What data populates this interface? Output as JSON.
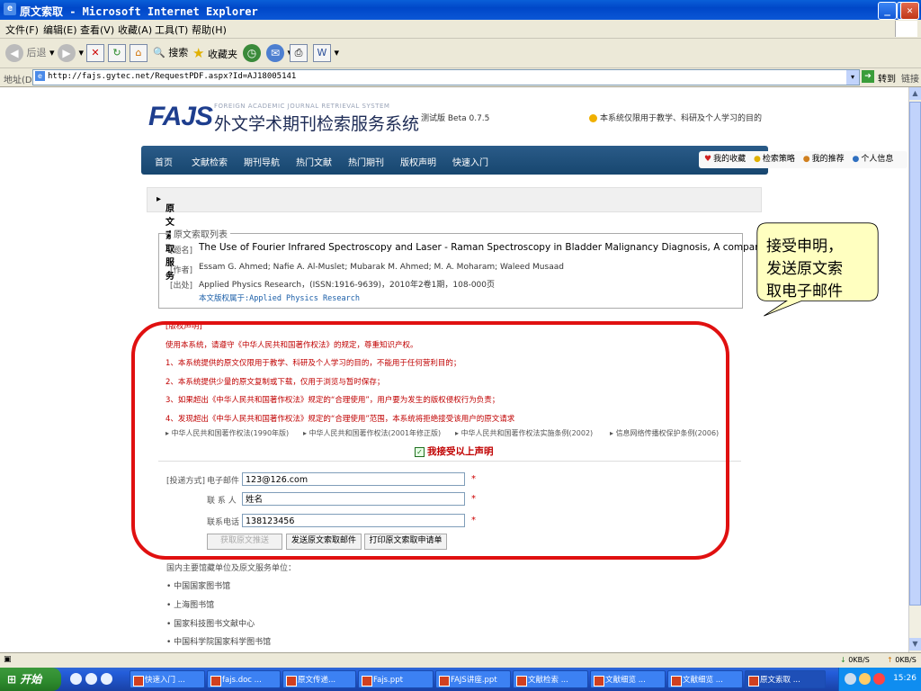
{
  "window": {
    "title": "原文索取 - Microsoft Internet Explorer",
    "controls": [
      "_",
      "❐",
      "✕"
    ]
  },
  "menu": [
    "文件(F)",
    "编辑(E)",
    "查看(V)",
    "收藏(A)",
    "工具(T)",
    "帮助(H)"
  ],
  "toolbar": {
    "back": "后退",
    "search": "搜索",
    "favorites": "收藏夹"
  },
  "address": {
    "label": "地址(D)",
    "url": "http://fajs.gytec.net/RequestPDF.aspx?Id=AJ18005141",
    "go": "转到",
    "links": "链接"
  },
  "page": {
    "logo_fajs": "FAJS",
    "logo_en": "FOREIGN ACADEMIC JOURNAL RETRIEVAL SYSTEM",
    "logo_cn": "外文学术期刊检索服务系统",
    "beta": "测试版 Beta 0.7.5",
    "notice": "本系统仅限用于教学、科研及个人学习的目的",
    "nav": [
      "首页",
      "文献检索",
      "期刊导航",
      "热门文献",
      "热门期刊",
      "版权声明",
      "快速入门"
    ],
    "nav_right": [
      "我的收藏",
      "检索策略",
      "我的推荐",
      "个人信息"
    ],
    "section_title": "原文索取服务",
    "list_legend": "原文索取列表",
    "article": {
      "title_label": "[题名]",
      "title": "The Use of Fourier Infrared Spectroscopy and Laser - Raman Spectroscopy in Bladder Malignancy Diagnosis, A comparative Study",
      "author_label": "[作者]",
      "authors": "Essam G. Ahmed; Nafie A. Al-Muslet; Mubarak M. Ahmed; M. A. Moharam; Waleed Musaad",
      "source_label": "[出处]",
      "source": "Applied Physics Research，(ISSN:1916-9639)，2010年2卷1期，108-000页",
      "copyright": "本文版权属于:Applied Physics Research"
    },
    "statement_head": "[版权声明]",
    "statement": [
      "使用本系统，请遵守《中华人民共和国著作权法》的规定，尊重知识产权。",
      "1、本系统提供的原文仅限用于教学、科研及个人学习的目的，不能用于任何营利目的；",
      "2、本系统提供少量的原文复制或下载，仅用于浏览与暂时保存；",
      "3、如果超出《中华人民共和国著作权法》规定的“合理使用”，用户要为发生的版权侵权行为负责；",
      "4、发现超出《中华人民共和国著作权法》规定的“合理使用”范围，本系统将拒绝接受该用户的原文请求"
    ],
    "laws": [
      "中华人民共和国著作权法(1990年版)",
      "中华人民共和国著作权法(2001年修正版)",
      "中华人民共和国著作权法实施条例(2002)",
      "信息网络传播权保护条例(2006)"
    ],
    "accept_label": "我接受以上声明",
    "form": {
      "delivery_label": "[投递方式]",
      "email_label": "电子邮件",
      "email_value": "123@126.com",
      "contact_label": "联 系 人",
      "contact_value": "姓名",
      "phone_label": "联系电话",
      "phone_value": "138123456",
      "required": "*",
      "btn_fetch": "获取原文推送",
      "btn_send": "发送原文索取邮件",
      "btn_print": "打印原文索取申请单"
    },
    "sites_head": "国内主要馆藏单位及原文服务单位：",
    "sites": [
      "中国国家图书馆",
      "上海图书馆",
      "国家科技图书文献中心",
      "中国科学院国家科学图书馆"
    ]
  },
  "callout": {
    "line1": "接受申明，",
    "line2": "发送原文索",
    "line3": "取电子邮件"
  },
  "statusbar": {
    "down": "0KB/S",
    "up": "0KB/S"
  },
  "taskbar": {
    "start": "开始",
    "tasks": [
      "快速入门 ...",
      "fajs.doc ...",
      "原文传递...",
      "Fajs.ppt",
      "FAJS讲座.ppt",
      "文献检索 ...",
      "文献细览 ...",
      "文献细览 ...",
      "原文索取 ..."
    ],
    "clock": "15:26"
  },
  "colors": {
    "callout_fill": "#ffffc0",
    "annotation_red": "#e01010",
    "nav_blue": "#1f4f7c"
  }
}
